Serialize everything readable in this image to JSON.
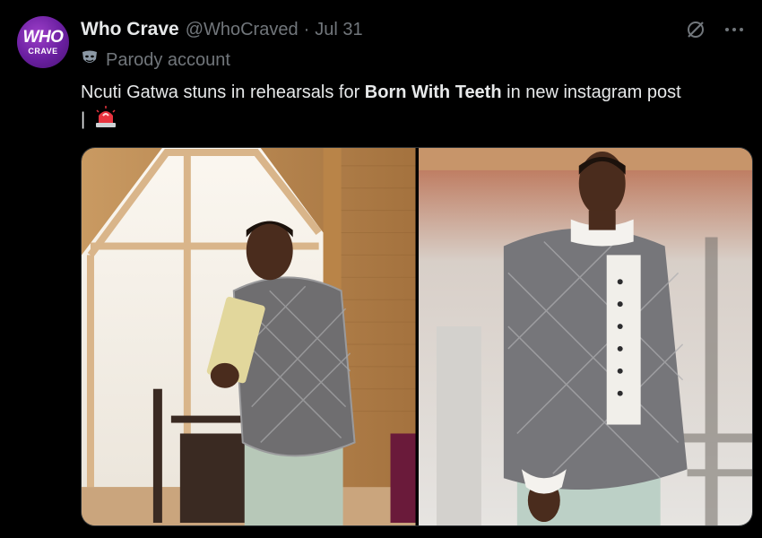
{
  "avatar": {
    "line1": "WHO",
    "line2": "CRAVE"
  },
  "author": {
    "name": "Who Crave",
    "handle": "@WhoCraved",
    "separator": "·",
    "date": "Jul 31"
  },
  "parody": {
    "label": "Parody account"
  },
  "tweet": {
    "pre": "Ncuti Gatwa stuns in rehearsals for ",
    "bold": "Born With Teeth",
    "post": " in new instagram post",
    "line2": "|"
  },
  "icons": {
    "grok": "grok-icon",
    "more": "more-icon",
    "parody": "theater-mask-icon",
    "siren": "siren-emoji-icon"
  },
  "colors": {
    "background": "#000000",
    "text": "#e7e9ea",
    "muted": "#71767b",
    "avatar": "#6a1fa0"
  }
}
